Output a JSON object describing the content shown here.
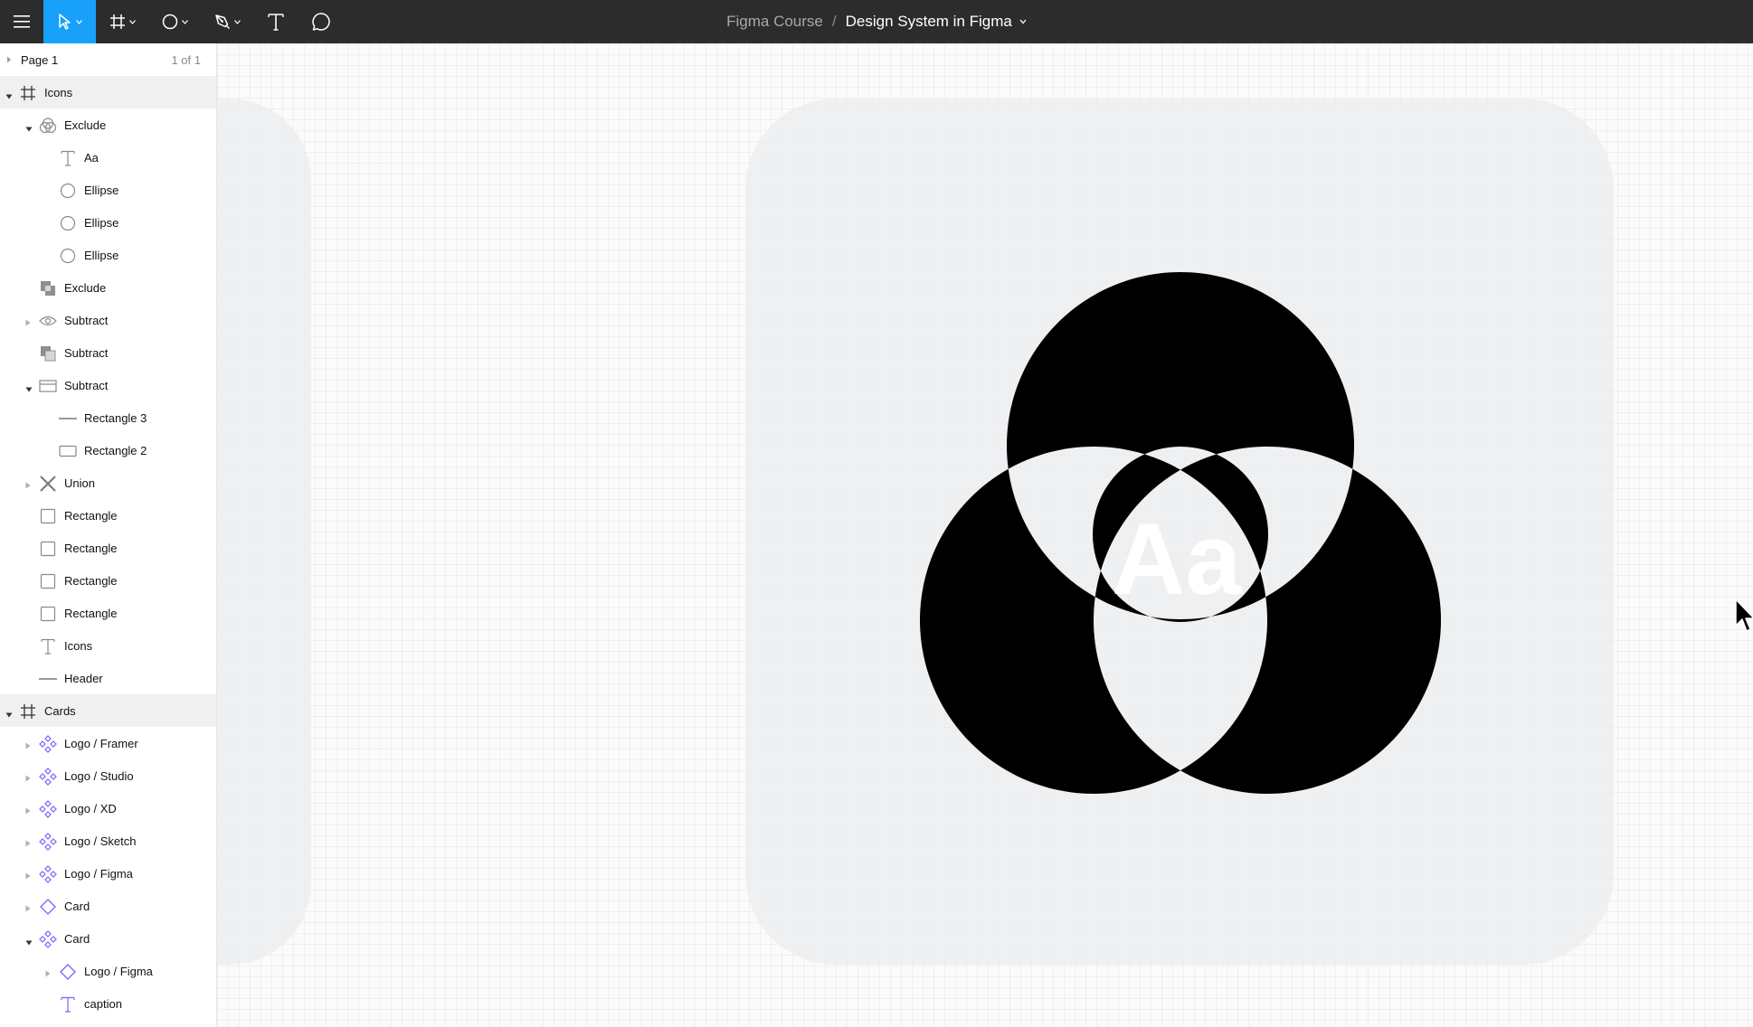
{
  "toolbar": {
    "tools": [
      {
        "name": "menu",
        "icon": "hamburger-menu-icon"
      },
      {
        "name": "move",
        "icon": "move-arrow-icon",
        "active": true
      },
      {
        "name": "frame",
        "icon": "frame-hash-icon"
      },
      {
        "name": "shape",
        "icon": "ellipse-icon"
      },
      {
        "name": "pen",
        "icon": "pen-icon"
      },
      {
        "name": "text",
        "icon": "text-t-icon"
      },
      {
        "name": "comment",
        "icon": "comment-bubble-icon"
      }
    ],
    "active_color": "#18a0fb",
    "background": "#2c2c2c"
  },
  "doc": {
    "project": "Figma Course",
    "separator": "/",
    "file": "Design System in Figma"
  },
  "pages": {
    "current": "Page 1",
    "count": "1 of 1"
  },
  "layers": [
    {
      "label": "Icons",
      "icon": "frame-icon",
      "twirl": "open",
      "level": 0,
      "selected": true
    },
    {
      "label": "Exclude",
      "icon": "boolean-exclude-icon",
      "twirl": "open",
      "level": 1
    },
    {
      "label": "Aa",
      "icon": "text-icon",
      "twirl": "none",
      "level": 2
    },
    {
      "label": "Ellipse",
      "icon": "ellipse-icon",
      "twirl": "none",
      "level": 2
    },
    {
      "label": "Ellipse",
      "icon": "ellipse-icon",
      "twirl": "none",
      "level": 2
    },
    {
      "label": "Ellipse",
      "icon": "ellipse-icon",
      "twirl": "none",
      "level": 2
    },
    {
      "label": "Exclude",
      "icon": "exclude-squares-icon",
      "twirl": "none",
      "level": 1
    },
    {
      "label": "Subtract",
      "icon": "eye-icon",
      "twirl": "closed",
      "level": 1
    },
    {
      "label": "Subtract",
      "icon": "subtract-squares-icon",
      "twirl": "none",
      "level": 1
    },
    {
      "label": "Subtract",
      "icon": "subtract-rect-icon",
      "twirl": "open",
      "level": 1
    },
    {
      "label": "Rectangle 3",
      "icon": "line-icon",
      "twirl": "none",
      "level": 2
    },
    {
      "label": "Rectangle 2",
      "icon": "rectangle-icon",
      "twirl": "none",
      "level": 2
    },
    {
      "label": "Union",
      "icon": "union-x-icon",
      "twirl": "closed",
      "level": 1
    },
    {
      "label": "Rectangle",
      "icon": "square-icon",
      "twirl": "none",
      "level": 1
    },
    {
      "label": "Rectangle",
      "icon": "square-icon",
      "twirl": "none",
      "level": 1
    },
    {
      "label": "Rectangle",
      "icon": "square-icon",
      "twirl": "none",
      "level": 1
    },
    {
      "label": "Rectangle",
      "icon": "square-icon",
      "twirl": "none",
      "level": 1
    },
    {
      "label": "Icons",
      "icon": "text-icon",
      "twirl": "none",
      "level": 1
    },
    {
      "label": "Header",
      "icon": "line-icon",
      "twirl": "none",
      "level": 1
    },
    {
      "label": "Cards",
      "icon": "frame-icon",
      "twirl": "open",
      "level": 0,
      "selected": true
    },
    {
      "label": "Logo / Framer",
      "icon": "component-icon",
      "twirl": "closed",
      "level": 1
    },
    {
      "label": "Logo / Studio",
      "icon": "component-icon",
      "twirl": "closed",
      "level": 1
    },
    {
      "label": "Logo / XD",
      "icon": "component-icon",
      "twirl": "closed",
      "level": 1
    },
    {
      "label": "Logo / Sketch",
      "icon": "component-icon",
      "twirl": "closed",
      "level": 1
    },
    {
      "label": "Logo / Figma",
      "icon": "component-icon",
      "twirl": "closed",
      "level": 1
    },
    {
      "label": "Card",
      "icon": "instance-icon",
      "twirl": "closed",
      "level": 1
    },
    {
      "label": "Card",
      "icon": "component-icon",
      "twirl": "open",
      "level": 1
    },
    {
      "label": "Logo / Figma",
      "icon": "instance-icon",
      "twirl": "closed",
      "level": 2
    },
    {
      "label": "caption",
      "icon": "text-purple-icon",
      "twirl": "none",
      "level": 2
    }
  ],
  "canvas": {
    "icon_text": "Aa",
    "component_color": "#7b61ff"
  }
}
